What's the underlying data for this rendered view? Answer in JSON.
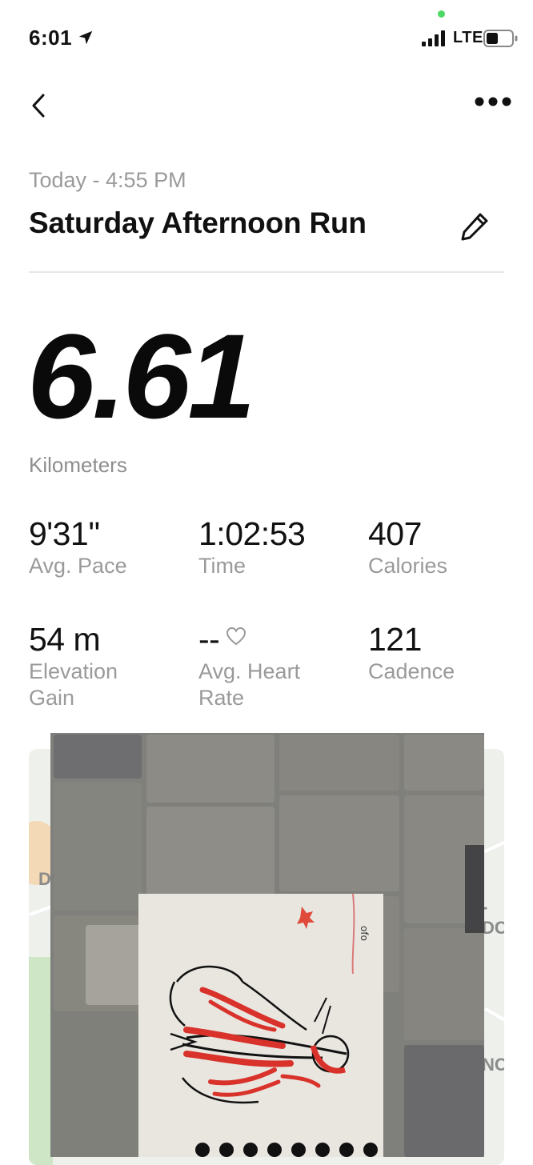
{
  "status_bar": {
    "time": "6:01",
    "network": "LTE"
  },
  "header": {
    "date_line": "Today - 4:55 PM",
    "title": "Saturday Afternoon Run"
  },
  "distance": {
    "value": "6.61",
    "unit": "Kilometers"
  },
  "stats": [
    {
      "value": "9'31''",
      "label": "Avg. Pace"
    },
    {
      "value": "1:02:53",
      "label": "Time"
    },
    {
      "value": "407",
      "label": "Calories"
    },
    {
      "value": "54 m",
      "label": "Elevation Gain"
    },
    {
      "value": "--",
      "label": "Avg. Heart Rate"
    },
    {
      "value": "121",
      "label": "Cadence"
    }
  ],
  "map": {
    "labels": [
      "D",
      "-DC",
      "NC"
    ]
  },
  "colors": {
    "text_primary": "#111111",
    "text_secondary": "#9a9a9a",
    "status_dot": "#4cd964",
    "divider": "#e6e6e6",
    "sketch_red": "#d8322b"
  },
  "icons": {
    "back": "chevron-left-icon",
    "more": "more-horizontal-icon",
    "edit": "pencil-icon",
    "heart": "heart-outline-icon",
    "location": "location-arrow-icon",
    "signal": "cellular-signal-icon",
    "battery": "battery-icon"
  }
}
